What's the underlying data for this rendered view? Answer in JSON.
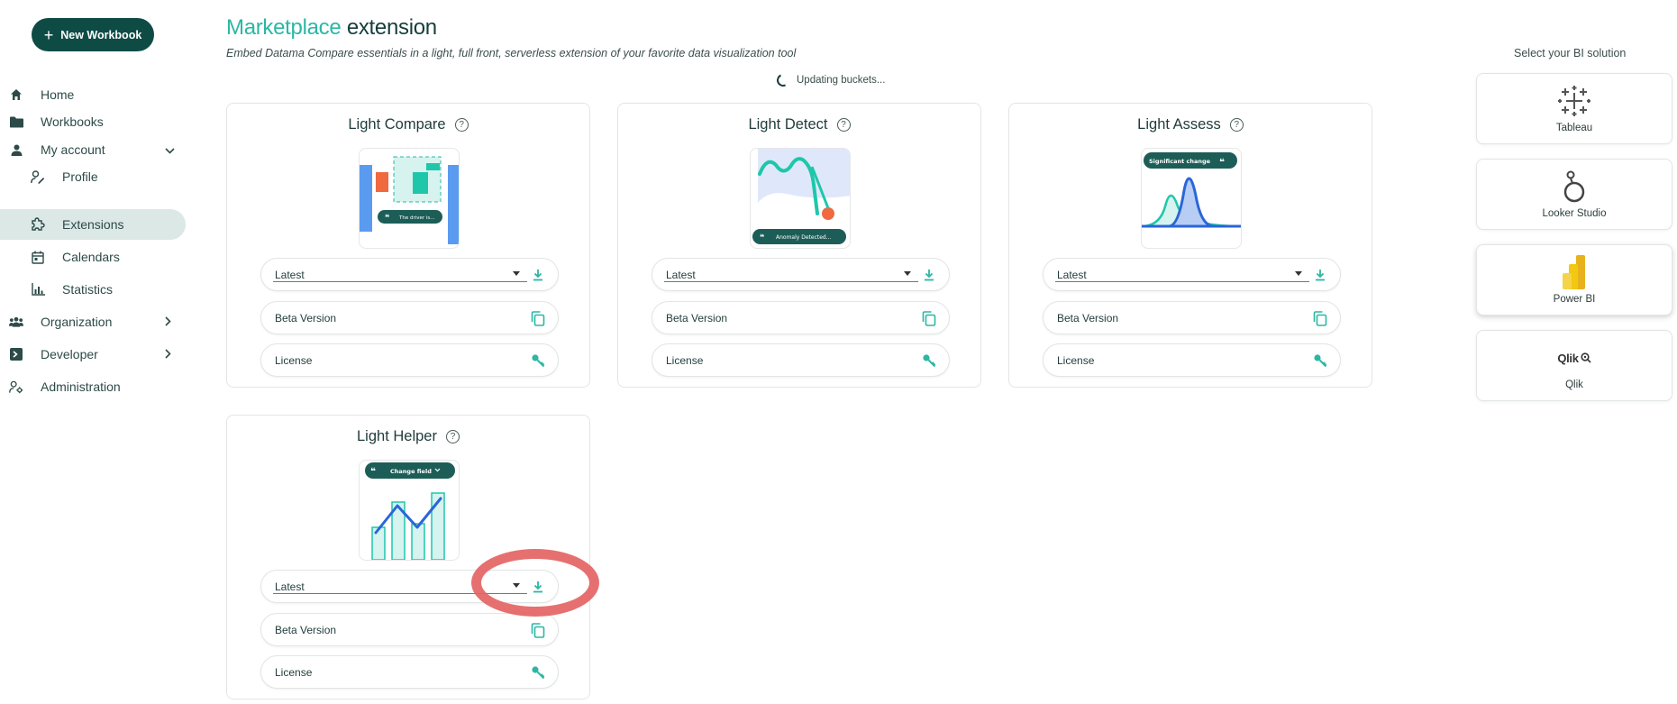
{
  "sidebar": {
    "new_workbook": "New Workbook",
    "items": [
      {
        "label": "Home",
        "icon": "home-icon"
      },
      {
        "label": "Workbooks",
        "icon": "folder-icon"
      },
      {
        "label": "My account",
        "icon": "user-icon"
      },
      {
        "label": "Profile",
        "icon": "profile-edit-icon"
      },
      {
        "label": "Extensions",
        "icon": "puzzle-icon"
      },
      {
        "label": "Calendars",
        "icon": "calendar-icon"
      },
      {
        "label": "Statistics",
        "icon": "bar-chart-icon"
      },
      {
        "label": "Organization",
        "icon": "group-icon"
      },
      {
        "label": "Developer",
        "icon": "terminal-icon"
      },
      {
        "label": "Administration",
        "icon": "user-gear-icon"
      }
    ]
  },
  "header": {
    "title_accent": "Marketplace",
    "title_rest": "extension",
    "subtitle": "Embed Datama Compare essentials in a light, full front, serverless extension of your favorite data visualization tool",
    "status": "Updating buckets..."
  },
  "cards": [
    {
      "title": "Light Compare",
      "bubble": "The driver is...",
      "version": "Latest",
      "beta": "Beta Version",
      "license": "License"
    },
    {
      "title": "Light Detect",
      "bubble": "Anomaly Detected...",
      "version": "Latest",
      "beta": "Beta Version",
      "license": "License"
    },
    {
      "title": "Light Assess",
      "bubble": "Significant change",
      "version": "Latest",
      "beta": "Beta Version",
      "license": "License"
    },
    {
      "title": "Light Helper",
      "bubble": "Change field",
      "version": "Latest",
      "beta": "Beta Version",
      "license": "License"
    }
  ],
  "bi_panel": {
    "heading": "Select your BI solution",
    "options": [
      {
        "label": "Tableau"
      },
      {
        "label": "Looker Studio"
      },
      {
        "label": "Power BI",
        "selected": true
      },
      {
        "label": "Qlik",
        "logo_text": "Qlik"
      }
    ]
  },
  "colors": {
    "brand_dark": "#0f4b45",
    "accent": "#2bb7a3",
    "annotation": "#e46464"
  }
}
